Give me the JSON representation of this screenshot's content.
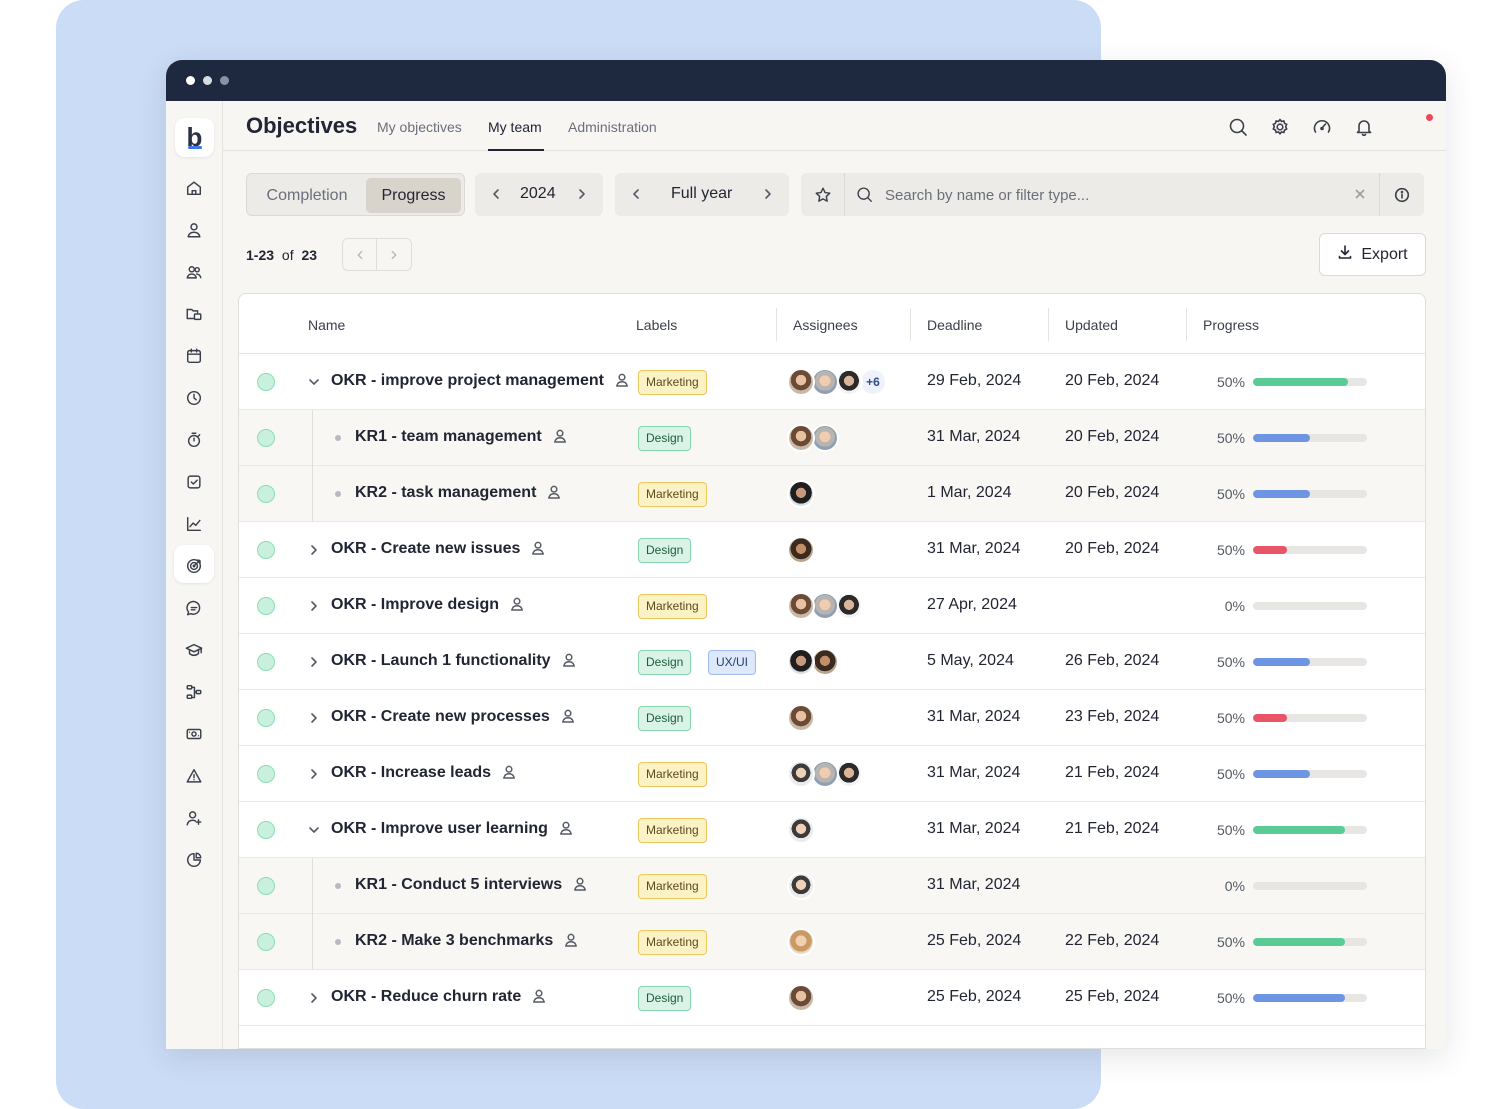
{
  "app": {
    "title": "Objectives",
    "logo_letter": "b"
  },
  "nav": {
    "tabs": [
      {
        "label": "My objectives",
        "active": false
      },
      {
        "label": "My team",
        "active": true
      },
      {
        "label": "Administration",
        "active": false
      }
    ],
    "icons": [
      "search-icon",
      "settings-icon",
      "speedometer-icon",
      "bell-icon",
      "avatar"
    ]
  },
  "sidebar": {
    "icons": [
      "home-icon",
      "user-icon",
      "team-icon",
      "folders-icon",
      "calendar-icon",
      "clock-icon",
      "stopwatch-icon",
      "checkbox-icon",
      "chart-icon",
      "target-icon",
      "chat-icon",
      "graduation-icon",
      "workflow-icon",
      "cash-icon",
      "warning-icon",
      "add-user-icon",
      "pie-chart-icon"
    ],
    "active": "target-icon"
  },
  "toolbar": {
    "view_options": [
      {
        "label": "Completion",
        "active": false
      },
      {
        "label": "Progress",
        "active": true
      }
    ],
    "year": "2024",
    "period": "Full year",
    "search_placeholder": "Search by name or filter type...",
    "search_value": "",
    "export_label": "Export"
  },
  "pagination": {
    "range": "1-23",
    "of": "of",
    "total": "23"
  },
  "table": {
    "headers": [
      "Name",
      "Labels",
      "Assignees",
      "Deadline",
      "Updated",
      "Progress"
    ],
    "rows": [
      {
        "name": "OKR - improve project management",
        "level": 0,
        "expanded": true,
        "labels": [
          "Marketing"
        ],
        "assignees": [
          "a1",
          "a2",
          "a3"
        ],
        "more": "+6",
        "deadline": "29 Feb, 2024",
        "updated": "20 Feb, 2024",
        "progress_text": "50%",
        "progress": 0.83,
        "color": "#5acb95"
      },
      {
        "name": "KR1 - team management",
        "level": 1,
        "labels": [
          "Design"
        ],
        "assignees": [
          "a1",
          "a2"
        ],
        "deadline": "31 Mar, 2024",
        "updated": "20 Feb, 2024",
        "progress_text": "50%",
        "progress": 0.5,
        "color": "#6e95e3"
      },
      {
        "name": "KR2 - task management",
        "level": 1,
        "labels": [
          "Marketing"
        ],
        "assignees": [
          "a4"
        ],
        "deadline": "1 Mar, 2024",
        "updated": "20 Feb, 2024",
        "progress_text": "50%",
        "progress": 0.5,
        "color": "#6e95e3"
      },
      {
        "name": "OKR - Create new issues",
        "level": 0,
        "expanded": false,
        "labels": [
          "Design"
        ],
        "assignees": [
          "a5"
        ],
        "deadline": "31 Mar, 2024",
        "updated": "20 Feb, 2024",
        "progress_text": "50%",
        "progress": 0.3,
        "color": "#e85566"
      },
      {
        "name": "OKR - Improve design",
        "level": 0,
        "expanded": false,
        "labels": [
          "Marketing"
        ],
        "assignees": [
          "a1",
          "a2",
          "a3"
        ],
        "deadline": "27 Apr, 2024",
        "updated": "",
        "progress_text": "0%",
        "progress": 0,
        "color": "#6e95e3"
      },
      {
        "name": "OKR - Launch 1 functionality",
        "level": 0,
        "expanded": false,
        "labels": [
          "Design",
          "UX/UI"
        ],
        "assignees": [
          "a4",
          "a5"
        ],
        "deadline": "5 May, 2024",
        "updated": "26 Feb, 2024",
        "progress_text": "50%",
        "progress": 0.5,
        "color": "#6e95e3"
      },
      {
        "name": "OKR - Create new processes",
        "level": 0,
        "expanded": false,
        "labels": [
          "Design"
        ],
        "assignees": [
          "a1"
        ],
        "deadline": "31 Mar, 2024",
        "updated": "23 Feb, 2024",
        "progress_text": "50%",
        "progress": 0.3,
        "color": "#e85566"
      },
      {
        "name": "OKR - Increase leads",
        "level": 0,
        "expanded": false,
        "labels": [
          "Marketing"
        ],
        "assignees": [
          "a6",
          "a2",
          "a3"
        ],
        "deadline": "31 Mar, 2024",
        "updated": "21 Feb, 2024",
        "progress_text": "50%",
        "progress": 0.5,
        "color": "#6e95e3"
      },
      {
        "name": "OKR - Improve user learning",
        "level": 0,
        "expanded": true,
        "labels": [
          "Marketing"
        ],
        "assignees": [
          "a6"
        ],
        "deadline": "31 Mar, 2024",
        "updated": "21 Feb, 2024",
        "progress_text": "50%",
        "progress": 0.81,
        "color": "#5acb95"
      },
      {
        "name": "KR1 - Conduct 5 interviews",
        "level": 1,
        "labels": [
          "Marketing"
        ],
        "assignees": [
          "a6"
        ],
        "deadline": "31 Mar, 2024",
        "updated": "",
        "progress_text": "0%",
        "progress": 0,
        "color": "#6e95e3"
      },
      {
        "name": "KR2 - Make 3 benchmarks",
        "level": 1,
        "labels": [
          "Marketing"
        ],
        "assignees": [
          "a7"
        ],
        "deadline": "25 Feb, 2024",
        "updated": "22 Feb, 2024",
        "progress_text": "50%",
        "progress": 0.81,
        "color": "#5acb95"
      },
      {
        "name": "OKR - Reduce churn rate",
        "level": 0,
        "expanded": false,
        "labels": [
          "Design"
        ],
        "assignees": [
          "a1"
        ],
        "deadline": "25 Feb, 2024",
        "updated": "25 Feb, 2024",
        "progress_text": "50%",
        "progress": 0.81,
        "color": "#6e95e3"
      }
    ]
  }
}
